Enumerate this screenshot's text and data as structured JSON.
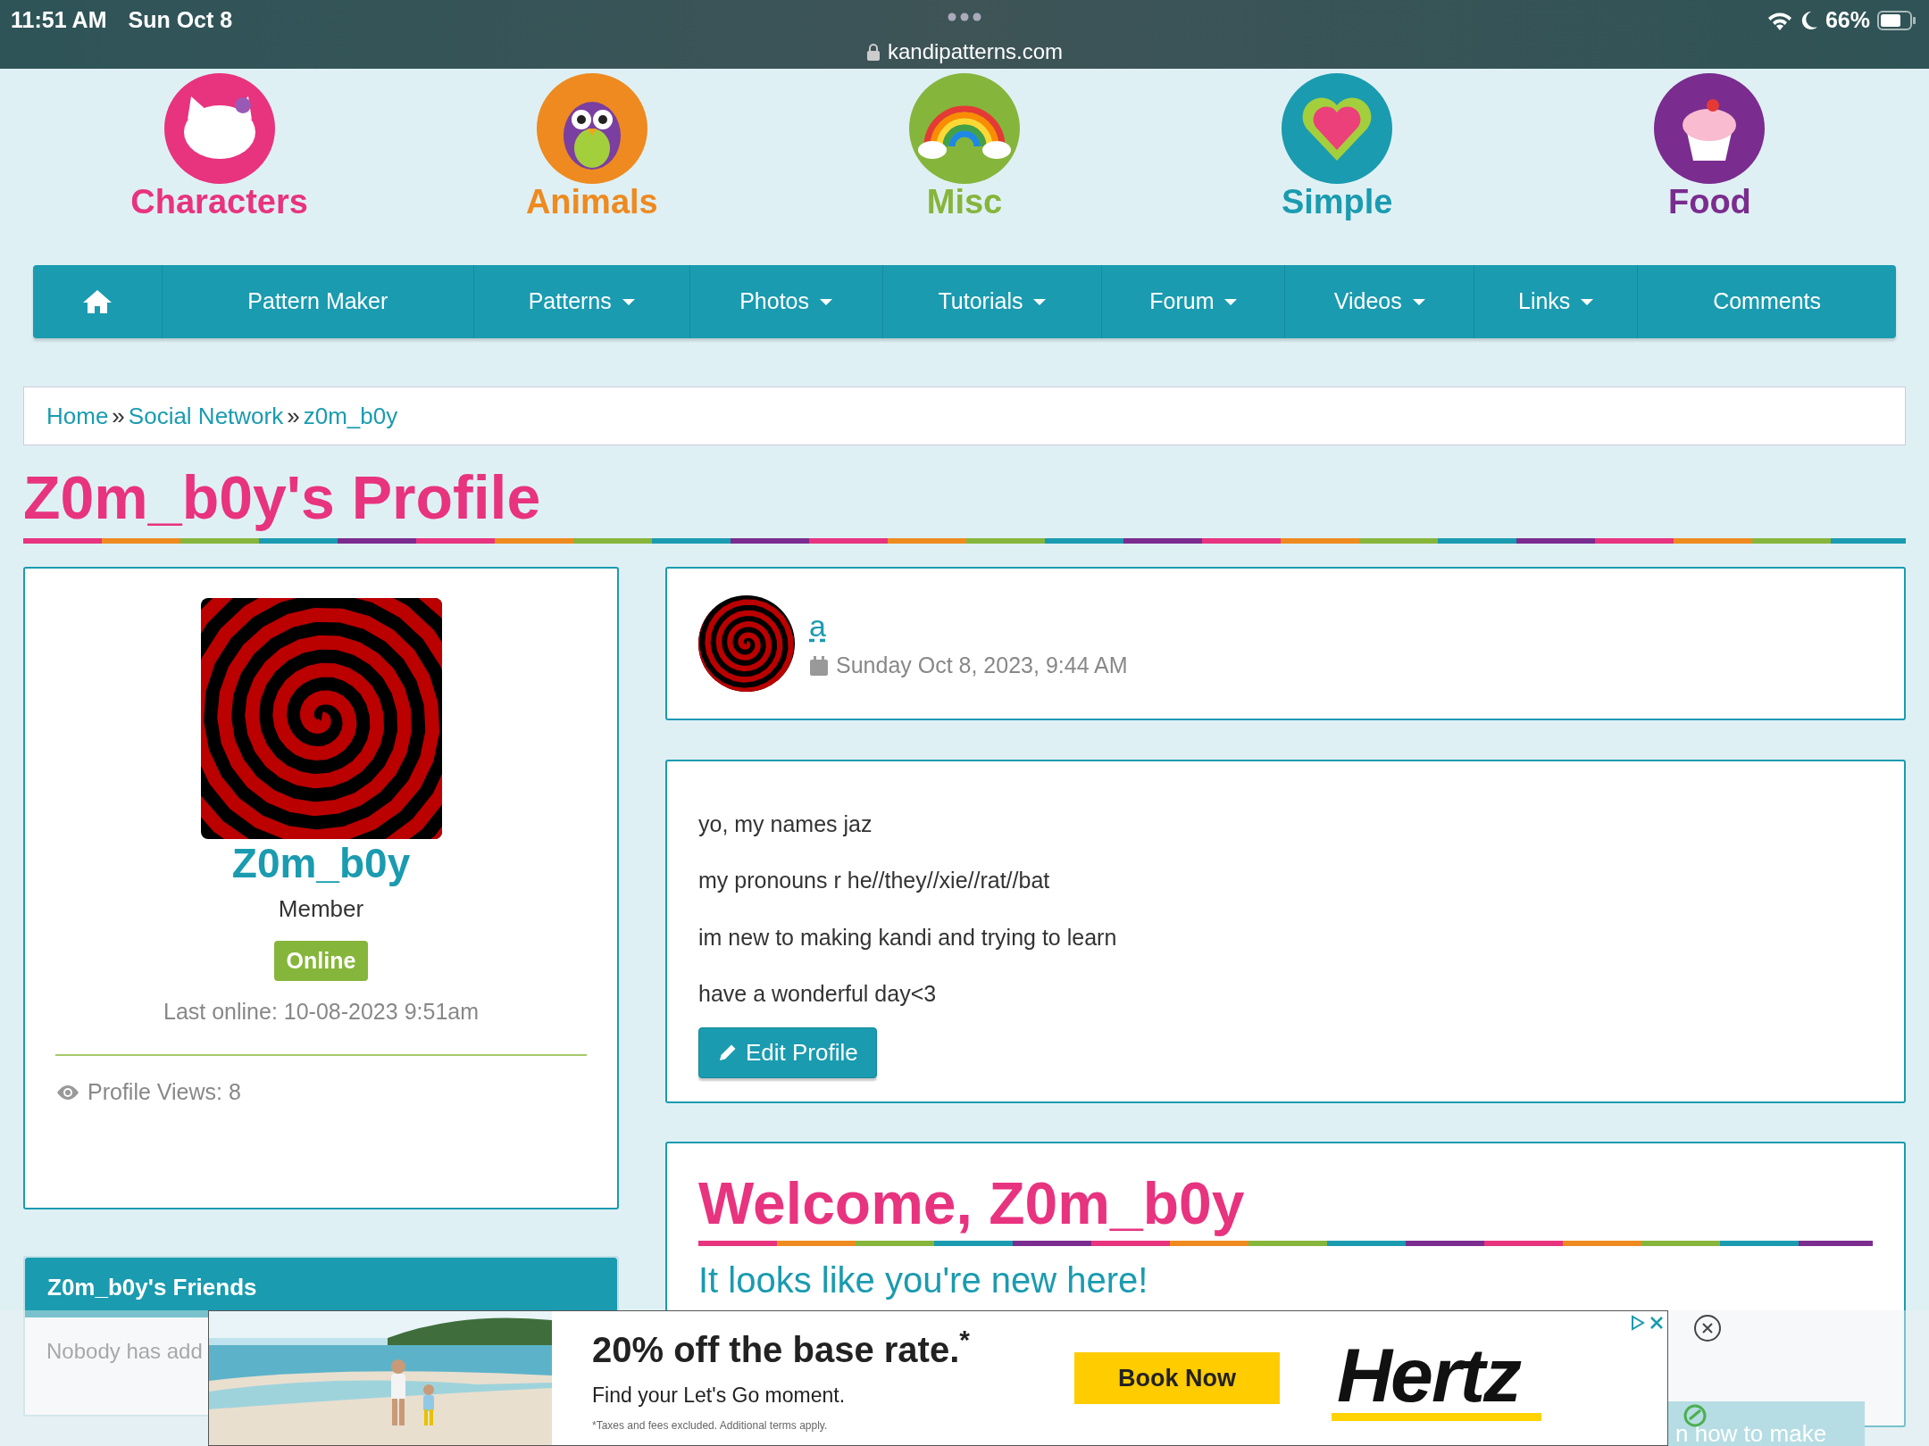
{
  "status_bar": {
    "time": "11:51 AM",
    "date": "Sun Oct 8",
    "url": "kandipatterns.com",
    "battery": "66%"
  },
  "categories": [
    {
      "label": "Characters",
      "color": "#e8337f",
      "kind": "cat"
    },
    {
      "label": "Animals",
      "color": "#ee8a1f",
      "kind": "owl"
    },
    {
      "label": "Misc",
      "color": "#86b53c",
      "kind": "rainbow"
    },
    {
      "label": "Simple",
      "color": "#1a9bb0",
      "kind": "heart"
    },
    {
      "label": "Food",
      "color": "#7a2c8f",
      "kind": "cupcake"
    }
  ],
  "nav": [
    {
      "kind": "home"
    },
    {
      "kind": "link",
      "label": "Pattern Maker"
    },
    {
      "kind": "dropdown",
      "label": "Patterns"
    },
    {
      "kind": "dropdown",
      "label": "Photos"
    },
    {
      "kind": "dropdown",
      "label": "Tutorials"
    },
    {
      "kind": "dropdown",
      "label": "Forum"
    },
    {
      "kind": "dropdown",
      "label": "Videos"
    },
    {
      "kind": "dropdown",
      "label": "Links"
    },
    {
      "kind": "link",
      "label": "Comments"
    }
  ],
  "breadcrumb": {
    "items": [
      "Home",
      "Social Network",
      "z0m_b0y"
    ],
    "separator": "»"
  },
  "title": "Z0m_b0y's Profile",
  "profile": {
    "name": "Z0m_b0y",
    "role": "Member",
    "status": "Online",
    "last_online": "Last online: 10-08-2023 9:51am",
    "views": "Profile Views: 8"
  },
  "friends": {
    "title": "Z0m_b0y's Friends",
    "empty": "Nobody has add"
  },
  "post": {
    "author": "a",
    "date": "Sunday Oct 8, 2023, 9:44 AM"
  },
  "about": {
    "lines": [
      "yo, my names jaz",
      "my pronouns r he//they//xie//rat//bat",
      "im new to making kandi and trying to learn",
      "have a wonderful day<3"
    ],
    "button": "Edit Profile"
  },
  "welcome": {
    "title": "Welcome, Z0m_b0y",
    "subtitle": "It looks like you're new here!"
  },
  "side_box": {
    "text": "n how to make"
  },
  "ad": {
    "headline": "20% off the base rate.$^{*}$",
    "tagline": "Find your Let's Go moment.",
    "fine_print": "*Taxes and fees excluded. Additional terms apply.",
    "button": "Book Now",
    "brand": "Hertz"
  }
}
